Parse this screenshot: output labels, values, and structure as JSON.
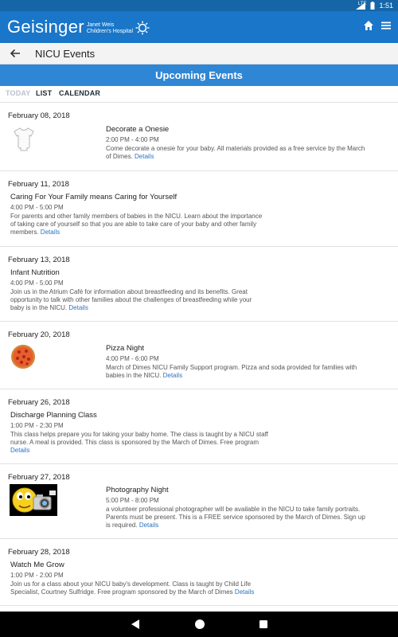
{
  "status_bar": {
    "signal": "LTE",
    "time": "1:51"
  },
  "app_bar": {
    "brand_name": "Geisinger",
    "brand_sub_line1": "Janet Weis",
    "brand_sub_line2": "Children's Hospital",
    "icons": [
      "home-icon",
      "menu-icon"
    ]
  },
  "page": {
    "title": "NICU Events",
    "banner": "Upcoming Events"
  },
  "tabs": {
    "today": "TODAY",
    "list": "LIST",
    "calendar": "CALENDAR"
  },
  "colors": {
    "primary": "#1976c9",
    "banner": "#2f86d5",
    "link": "#2a73c4"
  },
  "events": [
    {
      "date": "February 08, 2018",
      "title": "Decorate a Onesie",
      "time": "2:00 PM - 4:00 PM",
      "desc_lines": [
        "Come decorate a onesie for your baby. All materials provided as a free service by the March",
        "of Dimes."
      ],
      "details": "Details",
      "image": "onesie-image"
    },
    {
      "date": "February 11, 2018",
      "title": "Caring For Your Family means Caring for Yourself",
      "time": "4:00 PM - 5:00 PM",
      "desc_lines": [
        "For parents and other family members of babies in the NICU. Learn about the importance",
        "of taking care of yourself so that you are able to take care of your baby and other family",
        "members."
      ],
      "details": "Details"
    },
    {
      "date": "February 13, 2018",
      "title": "Infant Nutrition",
      "time": "4:00 PM - 5:00 PM",
      "desc_lines": [
        "Join us in the Atrium Café for information about breastfeeding and its benefits. Great",
        "opportunity to talk with other families about the challenges of breastfeeding while your",
        "baby is in the NICU."
      ],
      "details": "Details"
    },
    {
      "date": "February 20, 2018",
      "title": "Pizza Night",
      "time": "4:00 PM - 6:00 PM",
      "desc_lines": [
        "March of Dimes NICU Family Support program. Pizza and soda provided for families with",
        "babies in the NICU."
      ],
      "details": "Details",
      "image": "pizza-image"
    },
    {
      "date": "February 26, 2018",
      "title": "Discharge Planning Class",
      "time": "1:00 PM - 2:30 PM",
      "desc_lines": [
        "This class helps prepare you for taking your baby home. The class is taught by a NICU staff",
        "nurse. A meal is provided. This class is sponsored by the March of Dimes. Free program"
      ],
      "details": "Details"
    },
    {
      "date": "February 27, 2018",
      "title": "Photography Night",
      "time": "5:00 PM - 8:00 PM",
      "desc_lines": [
        "a volunteer professional photographer will be available in the NICU to take family portraits.",
        "Parents must be present. This is a FREE service sponsored by the March of Dimes. Sign up",
        "is required."
      ],
      "details": "Details",
      "image": "camera-smiley-image"
    },
    {
      "date": "February 28, 2018",
      "title": "Watch Me Grow",
      "time": "1:00 PM - 2:00 PM",
      "desc_lines": [
        "Join us for a class about your NICU baby's development. Class is taught by Child Life",
        "Specialist, Courtney Sulfridge. Free program sponsored by the March of Dimes"
      ],
      "details": "Details"
    }
  ],
  "nav_bar": {
    "icons": [
      "back-triangle-icon",
      "home-circle-icon",
      "recents-square-icon"
    ]
  }
}
